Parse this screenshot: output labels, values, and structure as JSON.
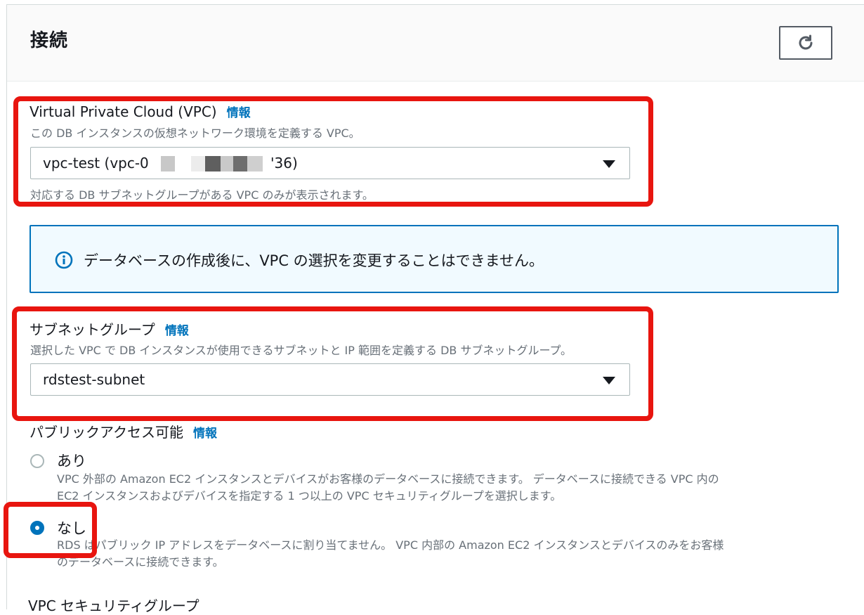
{
  "header": {
    "title": "接続",
    "refresh_icon": "refresh-icon"
  },
  "vpc": {
    "label": "Virtual Private Cloud (VPC)",
    "info": "情報",
    "description": "この DB インスタンスの仮想ネットワーク環境を定義する VPC。",
    "value_prefix": "vpc-test (vpc-0",
    "value_suffix": "'36)",
    "hint": "対応する DB サブネットグループがある VPC のみが表示されます。"
  },
  "alert": {
    "icon": "info-circle-icon",
    "text": "データベースの作成後に、VPC の選択を変更することはできません。"
  },
  "subnet": {
    "label": "サブネットグループ",
    "info": "情報",
    "description": "選択した VPC で DB インスタンスが使用できるサブネットと IP 範囲を定義する DB サブネットグループ。",
    "value": "rdstest-subnet"
  },
  "public_access": {
    "label": "パブリックアクセス可能",
    "info": "情報",
    "options": [
      {
        "label": "あり",
        "desc_line1": "VPC 外部の Amazon EC2 インスタンスとデバイスがお客様のデータベースに接続できます。 データベースに接続できる VPC 内の",
        "desc_line2": "EC2 インスタンスおよびデバイスを指定する 1 つ以上の VPC セキュリティグループを選択します。",
        "selected": false
      },
      {
        "label": "なし",
        "desc_line1": "RDS はパブリック IP アドレスをデータベースに割り当てません。 VPC 内部の Amazon EC2 インスタンスとデバイスのみをお客様",
        "desc_line2": "のデータベースに接続できます。",
        "selected": true
      }
    ]
  },
  "next_section_label": "VPC セキュリティグループ",
  "colors": {
    "highlight": "#e8150f",
    "link": "#0073bb",
    "alert_bg": "#f1faff"
  }
}
